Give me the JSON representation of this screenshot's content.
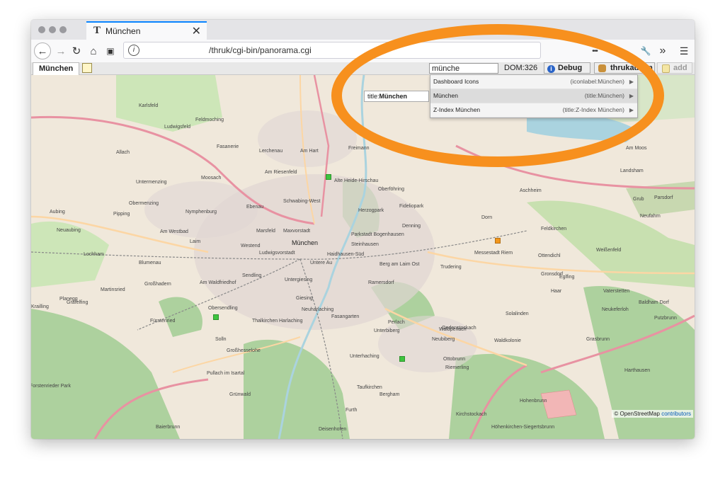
{
  "browser": {
    "tab_title": "München",
    "tab_favicon": "T",
    "tab_close": "✕",
    "url": "/thruk/cgi-bin/panorama.cgi",
    "icons": {
      "back": "←",
      "forward": "→",
      "reload": "↻",
      "home": "⌂",
      "extension": "▣",
      "info": "i",
      "more": "•••",
      "wrench": "🔧",
      "overflow": "»",
      "menu": "☰"
    }
  },
  "app": {
    "dashboard_tab": "München",
    "search_value": "münche",
    "dom_count": "DOM:326",
    "debug_label": "Debug",
    "user_label": "thrukadmin",
    "add_label": "add"
  },
  "autocomplete": {
    "tooltip_prefix": "title:",
    "tooltip_match": "München",
    "items": [
      {
        "label": "Dashboard Icons",
        "hint": "(iconlabel:München)",
        "active": false
      },
      {
        "label": "München",
        "hint": "(title:München)",
        "active": true
      },
      {
        "label": "Z-Index München",
        "hint": "(title:Z-Index München)",
        "active": false
      }
    ]
  },
  "map": {
    "attribution_prefix": "© OpenStreetMap",
    "attribution_link": "contributors",
    "places": [
      {
        "name": "Karlsfeld"
      },
      {
        "name": "Ludwigsfeld"
      },
      {
        "name": "Feldmoching"
      },
      {
        "name": "Am Hart"
      },
      {
        "name": "Freimann"
      },
      {
        "name": "Fasanerie"
      },
      {
        "name": "Lerchenau"
      },
      {
        "name": "Allach"
      },
      {
        "name": "Am Riesenfeld"
      },
      {
        "name": "Moosach"
      },
      {
        "name": "Alte Heide-Hirschau"
      },
      {
        "name": "Oberföhring"
      },
      {
        "name": "Untermenzing"
      },
      {
        "name": "Obermenzing"
      },
      {
        "name": "Schwabing-West"
      },
      {
        "name": "Herzogpark"
      },
      {
        "name": "Fideliopark"
      },
      {
        "name": "Nymphenburg"
      },
      {
        "name": "Ebenau"
      },
      {
        "name": "Pipping"
      },
      {
        "name": "Aubing"
      },
      {
        "name": "Neuaubing"
      },
      {
        "name": "Am Westbad"
      },
      {
        "name": "Laim"
      },
      {
        "name": "Marsfeld"
      },
      {
        "name": "Maxvorstadt"
      },
      {
        "name": "München",
        "big": true
      },
      {
        "name": "Parkstadt Bogenhausen"
      },
      {
        "name": "Denning"
      },
      {
        "name": "Westend"
      },
      {
        "name": "Ludwigsvorstadt"
      },
      {
        "name": "Haidhausen-Süd"
      },
      {
        "name": "Steinhausen"
      },
      {
        "name": "Lochham"
      },
      {
        "name": "Blumenau"
      },
      {
        "name": "Untere Au"
      },
      {
        "name": "Berg am Laim Ost"
      },
      {
        "name": "Trudering"
      },
      {
        "name": "Messestadt Riem"
      },
      {
        "name": "Sendling"
      },
      {
        "name": "Ramersdorf"
      },
      {
        "name": "Untergiesing"
      },
      {
        "name": "Am Waldfriedhof"
      },
      {
        "name": "Großhadern"
      },
      {
        "name": "Martinsried"
      },
      {
        "name": "Planegg"
      },
      {
        "name": "Obersendling"
      },
      {
        "name": "Thalkirchen"
      },
      {
        "name": "Giesing"
      },
      {
        "name": "Neuharlaching"
      },
      {
        "name": "Fasangarten"
      },
      {
        "name": "Perlach"
      },
      {
        "name": "Fürstenried"
      },
      {
        "name": "Harlaching"
      },
      {
        "name": "Unterbiberg"
      },
      {
        "name": "Waldperlach"
      },
      {
        "name": "Neubiberg"
      },
      {
        "name": "Solln"
      },
      {
        "name": "Großhesselohe"
      },
      {
        "name": "Unterhaching"
      },
      {
        "name": "Ottobrunn"
      },
      {
        "name": "Riemerling"
      },
      {
        "name": "Taufkirchen"
      },
      {
        "name": "Bergham"
      },
      {
        "name": "Furth"
      },
      {
        "name": "Deisenhofen"
      },
      {
        "name": "Baierbrunn"
      },
      {
        "name": "Hohenbrunn"
      },
      {
        "name": "Höhenkirchen-Siegertsbrunn"
      },
      {
        "name": "Aschheim"
      },
      {
        "name": "Landsham"
      },
      {
        "name": "Feldkirchen"
      },
      {
        "name": "Haar"
      },
      {
        "name": "Vaterstetten"
      },
      {
        "name": "Grasbrunn"
      },
      {
        "name": "Baldham Dorf"
      },
      {
        "name": "Putzbrunn"
      },
      {
        "name": "Parsdorf"
      },
      {
        "name": "Gronsdorf"
      },
      {
        "name": "Eglfing"
      },
      {
        "name": "Am Moos"
      },
      {
        "name": "Solalinden"
      },
      {
        "name": "Oedenstockach"
      },
      {
        "name": "Waldkolonie"
      },
      {
        "name": "Forstenrieder Park"
      },
      {
        "name": "Pullach im Isartal"
      },
      {
        "name": "Grünwald"
      },
      {
        "name": "Harthausen"
      },
      {
        "name": "Neukeferloh"
      },
      {
        "name": "Weißenfeld"
      },
      {
        "name": "Ottendichl"
      },
      {
        "name": "Kirchstockach"
      },
      {
        "name": "Gräfelfing"
      },
      {
        "name": "Krailling"
      },
      {
        "name": "Grub"
      },
      {
        "name": "Neufahrn"
      },
      {
        "name": "Dorn"
      }
    ]
  }
}
